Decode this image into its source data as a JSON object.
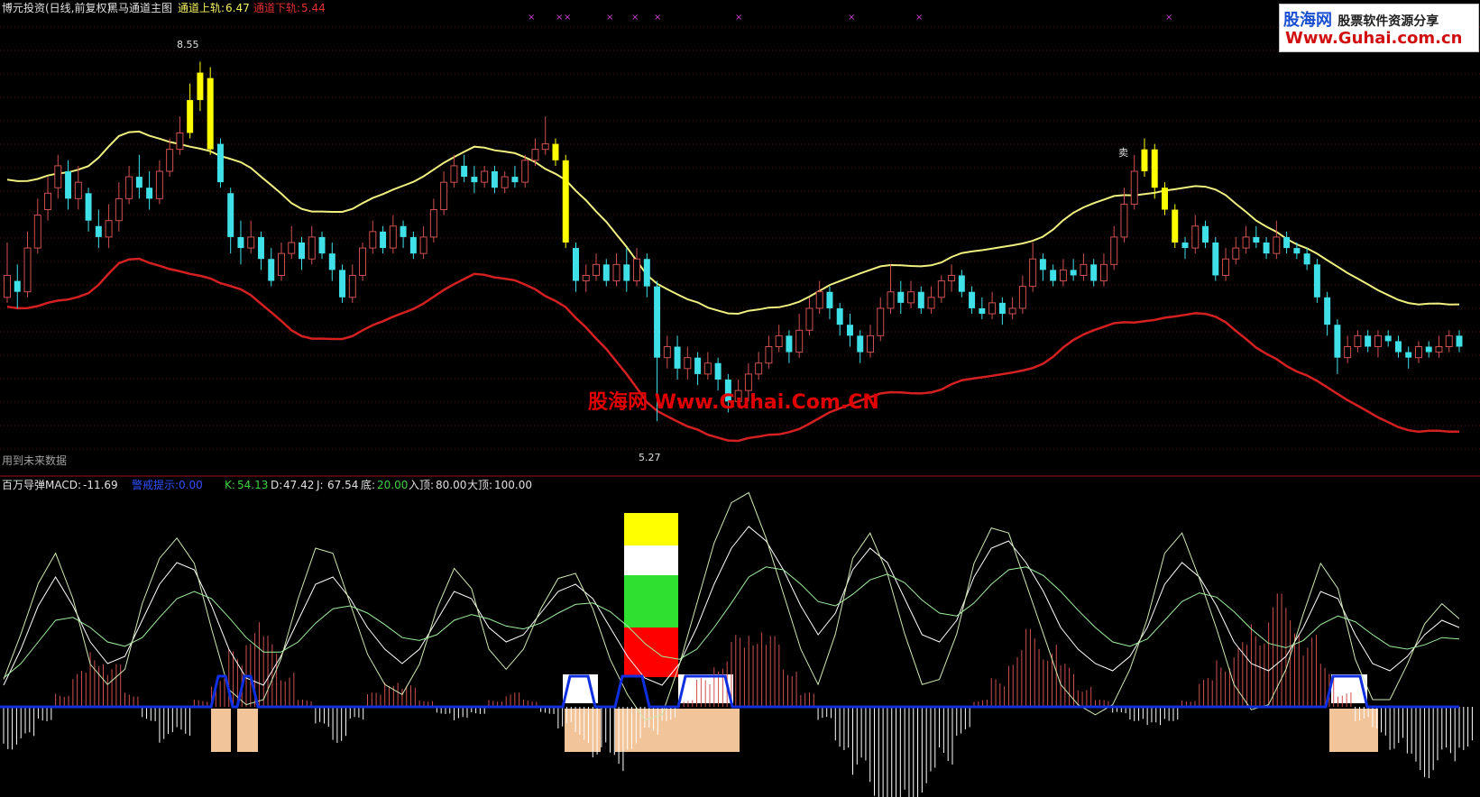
{
  "header": {
    "stock_name": "博元投资",
    "period_info": "(日线,前复权)",
    "indicator_name": "黑马通道主图",
    "upper_label": "通道上轨:",
    "upper_value": "6.47",
    "lower_label": "通道下轨:",
    "lower_value": "5.44"
  },
  "notice": {
    "future_data": "用到未来数据"
  },
  "annotations": {
    "high_price": "8.55",
    "low_price": "5.27",
    "arrow_label": "卖"
  },
  "sub_header": {
    "indicator": "百万导弹",
    "macd_label": "MACD:",
    "macd_value": "-11.69",
    "signal_label": "警戒提示:",
    "signal_value": "0.00",
    "k_label": "K:",
    "k_value": "54.13",
    "d_label": "D:",
    "d_value": "47.42",
    "j_label": "J:",
    "j_value": "67.54",
    "bottom_label": "底:",
    "bottom_value": "20.00",
    "entry_label": "入顶:",
    "entry_value": "80.00",
    "top_label": "大顶:",
    "top_value": "100.00"
  },
  "logo": {
    "brand": "股海网",
    "slogan": "股票软件资源分享",
    "url": "Www.Guhai.com.cn"
  },
  "watermark": {
    "text": "股海网 Www.Guhai.Com.CN"
  },
  "colors": {
    "upper_band": "#f0f080",
    "lower_band": "#d42020",
    "candle_up": "#d05050",
    "candle_down": "#40e0e8",
    "highlight": "#ffff00",
    "k_line": "#ffffff",
    "d_line": "#9ef09e",
    "j_line": "#cfe8b0",
    "macd_pos": "#d05050",
    "macd_neg": "#ffffff",
    "baseline": "#1030e0"
  },
  "chart_data": [
    {
      "type": "candlestick",
      "title": "黑马通道主图",
      "ylim": [
        5.0,
        8.8
      ],
      "price_high": 8.55,
      "price_low": 5.27,
      "candles": [
        [
          6.4,
          6.6,
          6.9,
          6.35
        ],
        [
          6.55,
          6.45,
          6.7,
          6.3
        ],
        [
          6.45,
          6.85,
          7.0,
          6.4
        ],
        [
          6.85,
          7.15,
          7.3,
          6.8
        ],
        [
          7.2,
          7.35,
          7.5,
          7.1
        ],
        [
          7.4,
          7.6,
          7.7,
          7.3
        ],
        [
          7.55,
          7.3,
          7.65,
          7.2
        ],
        [
          7.3,
          7.45,
          7.6,
          7.2
        ],
        [
          7.35,
          7.1,
          7.4,
          7.0
        ],
        [
          7.05,
          6.95,
          7.2,
          6.85
        ],
        [
          6.95,
          7.1,
          7.25,
          6.85
        ],
        [
          7.1,
          7.3,
          7.45,
          7.0
        ],
        [
          7.3,
          7.5,
          7.6,
          7.25
        ],
        [
          7.5,
          7.4,
          7.7,
          7.3
        ],
        [
          7.4,
          7.3,
          7.55,
          7.2
        ],
        [
          7.3,
          7.55,
          7.65,
          7.25
        ],
        [
          7.55,
          7.75,
          7.85,
          7.5
        ],
        [
          7.75,
          7.9,
          8.05,
          7.7
        ],
        [
          7.9,
          8.2,
          8.35,
          7.85
        ],
        [
          8.2,
          8.45,
          8.55,
          8.1
        ],
        [
          8.4,
          7.75,
          8.5,
          7.7
        ],
        [
          7.8,
          7.45,
          7.85,
          7.4
        ],
        [
          7.35,
          6.95,
          7.4,
          6.8
        ],
        [
          6.95,
          6.85,
          7.1,
          6.7
        ],
        [
          6.85,
          6.95,
          7.1,
          6.8
        ],
        [
          6.95,
          6.75,
          7.0,
          6.65
        ],
        [
          6.75,
          6.55,
          6.85,
          6.5
        ],
        [
          6.6,
          6.8,
          6.9,
          6.55
        ],
        [
          6.8,
          6.9,
          7.05,
          6.75
        ],
        [
          6.9,
          6.75,
          6.95,
          6.65
        ],
        [
          6.75,
          6.95,
          7.05,
          6.7
        ],
        [
          6.95,
          6.8,
          7.0,
          6.75
        ],
        [
          6.8,
          6.65,
          6.9,
          6.55
        ],
        [
          6.65,
          6.4,
          6.7,
          6.35
        ],
        [
          6.4,
          6.6,
          6.7,
          6.35
        ],
        [
          6.6,
          6.85,
          6.9,
          6.55
        ],
        [
          6.85,
          7.0,
          7.1,
          6.8
        ],
        [
          7.0,
          6.85,
          7.05,
          6.8
        ],
        [
          6.85,
          7.05,
          7.15,
          6.8
        ],
        [
          7.05,
          6.95,
          7.1,
          6.85
        ],
        [
          6.95,
          6.8,
          7.0,
          6.75
        ],
        [
          6.8,
          6.95,
          7.05,
          6.75
        ],
        [
          6.95,
          7.2,
          7.3,
          6.9
        ],
        [
          7.2,
          7.45,
          7.55,
          7.15
        ],
        [
          7.45,
          7.6,
          7.7,
          7.4
        ],
        [
          7.6,
          7.5,
          7.7,
          7.45
        ],
        [
          7.5,
          7.45,
          7.6,
          7.35
        ],
        [
          7.45,
          7.55,
          7.6,
          7.4
        ],
        [
          7.55,
          7.4,
          7.6,
          7.35
        ],
        [
          7.4,
          7.5,
          7.55,
          7.35
        ],
        [
          7.5,
          7.45,
          7.6,
          7.4
        ],
        [
          7.45,
          7.65,
          7.7,
          7.4
        ],
        [
          7.65,
          7.75,
          7.85,
          7.6
        ],
        [
          7.75,
          7.8,
          8.05,
          7.7
        ],
        [
          7.8,
          7.65,
          7.85,
          7.6
        ],
        [
          7.65,
          6.9,
          7.7,
          6.85
        ],
        [
          6.85,
          6.55,
          6.9,
          6.45
        ],
        [
          6.55,
          6.6,
          6.7,
          6.45
        ],
        [
          6.6,
          6.7,
          6.8,
          6.55
        ],
        [
          6.7,
          6.55,
          6.75,
          6.5
        ],
        [
          6.55,
          6.7,
          6.8,
          6.5
        ],
        [
          6.7,
          6.55,
          6.85,
          6.45
        ],
        [
          6.55,
          6.75,
          6.85,
          6.5
        ],
        [
          6.75,
          6.5,
          6.8,
          6.4
        ],
        [
          6.5,
          5.85,
          6.55,
          5.27
        ],
        [
          5.85,
          5.95,
          6.05,
          5.75
        ],
        [
          5.95,
          5.75,
          6.05,
          5.65
        ],
        [
          5.75,
          5.85,
          5.95,
          5.65
        ],
        [
          5.85,
          5.7,
          5.9,
          5.6
        ],
        [
          5.7,
          5.8,
          5.9,
          5.65
        ],
        [
          5.8,
          5.65,
          5.85,
          5.55
        ],
        [
          5.65,
          5.45,
          5.7,
          5.35
        ],
        [
          5.45,
          5.55,
          5.65,
          5.4
        ],
        [
          5.55,
          5.7,
          5.8,
          5.45
        ],
        [
          5.7,
          5.8,
          5.9,
          5.65
        ],
        [
          5.8,
          5.95,
          6.05,
          5.75
        ],
        [
          5.95,
          6.05,
          6.15,
          5.9
        ],
        [
          6.05,
          5.9,
          6.1,
          5.8
        ],
        [
          5.9,
          6.1,
          6.25,
          5.85
        ],
        [
          6.1,
          6.3,
          6.4,
          6.05
        ],
        [
          6.3,
          6.45,
          6.55,
          6.25
        ],
        [
          6.45,
          6.3,
          6.5,
          6.2
        ],
        [
          6.3,
          6.15,
          6.35,
          6.05
        ],
        [
          6.15,
          6.05,
          6.25,
          5.95
        ],
        [
          6.05,
          5.9,
          6.1,
          5.8
        ],
        [
          5.9,
          6.05,
          6.15,
          5.85
        ],
        [
          6.05,
          6.3,
          6.4,
          6.0
        ],
        [
          6.3,
          6.45,
          6.7,
          6.25
        ],
        [
          6.45,
          6.35,
          6.55,
          6.25
        ],
        [
          6.35,
          6.45,
          6.55,
          6.3
        ],
        [
          6.45,
          6.3,
          6.5,
          6.25
        ],
        [
          6.3,
          6.4,
          6.5,
          6.25
        ],
        [
          6.4,
          6.55,
          6.6,
          6.35
        ],
        [
          6.55,
          6.6,
          6.7,
          6.45
        ],
        [
          6.6,
          6.45,
          6.65,
          6.4
        ],
        [
          6.45,
          6.3,
          6.5,
          6.25
        ],
        [
          6.3,
          6.25,
          6.4,
          6.2
        ],
        [
          6.25,
          6.35,
          6.45,
          6.2
        ],
        [
          6.35,
          6.25,
          6.4,
          6.15
        ],
        [
          6.25,
          6.3,
          6.4,
          6.2
        ],
        [
          6.3,
          6.5,
          6.6,
          6.25
        ],
        [
          6.5,
          6.75,
          6.9,
          6.45
        ],
        [
          6.75,
          6.65,
          6.8,
          6.55
        ],
        [
          6.65,
          6.55,
          6.7,
          6.5
        ],
        [
          6.55,
          6.65,
          6.75,
          6.5
        ],
        [
          6.65,
          6.6,
          6.75,
          6.55
        ],
        [
          6.6,
          6.7,
          6.8,
          6.55
        ],
        [
          6.7,
          6.55,
          6.75,
          6.5
        ],
        [
          6.55,
          6.7,
          6.8,
          6.5
        ],
        [
          6.7,
          6.95,
          7.05,
          6.65
        ],
        [
          6.95,
          7.25,
          7.4,
          6.9
        ],
        [
          7.25,
          7.55,
          7.7,
          7.2
        ],
        [
          7.55,
          7.75,
          7.85,
          7.5
        ],
        [
          7.75,
          7.4,
          7.8,
          7.3
        ],
        [
          7.4,
          7.2,
          7.45,
          7.15
        ],
        [
          7.2,
          6.9,
          7.25,
          6.85
        ],
        [
          6.9,
          6.85,
          6.95,
          6.75
        ],
        [
          6.85,
          7.05,
          7.15,
          6.8
        ],
        [
          7.05,
          6.9,
          7.1,
          6.85
        ],
        [
          6.9,
          6.6,
          6.95,
          6.55
        ],
        [
          6.6,
          6.75,
          6.85,
          6.55
        ],
        [
          6.75,
          6.85,
          6.95,
          6.7
        ],
        [
          6.85,
          6.95,
          7.05,
          6.8
        ],
        [
          6.95,
          6.9,
          7.05,
          6.85
        ],
        [
          6.9,
          6.8,
          6.95,
          6.75
        ],
        [
          6.8,
          6.95,
          7.1,
          6.75
        ],
        [
          6.95,
          6.85,
          7.0,
          6.8
        ],
        [
          6.85,
          6.8,
          6.9,
          6.75
        ],
        [
          6.8,
          6.7,
          6.85,
          6.65
        ],
        [
          6.7,
          6.4,
          6.75,
          6.35
        ],
        [
          6.4,
          6.15,
          6.45,
          6.05
        ],
        [
          6.15,
          5.85,
          6.2,
          5.7
        ],
        [
          5.85,
          5.95,
          6.05,
          5.8
        ],
        [
          5.95,
          6.05,
          6.1,
          5.9
        ],
        [
          6.05,
          5.95,
          6.1,
          5.9
        ],
        [
          5.95,
          6.05,
          6.1,
          5.85
        ],
        [
          6.05,
          6.0,
          6.1,
          5.95
        ],
        [
          6.0,
          5.9,
          6.05,
          5.85
        ],
        [
          5.9,
          5.85,
          5.95,
          5.75
        ],
        [
          5.85,
          5.95,
          6.0,
          5.8
        ],
        [
          5.95,
          5.9,
          6.0,
          5.85
        ],
        [
          5.9,
          5.95,
          6.05,
          5.85
        ],
        [
          5.95,
          6.05,
          6.1,
          5.9
        ],
        [
          6.05,
          5.95,
          6.1,
          5.9
        ]
      ],
      "highlighted_candles": [
        18,
        19,
        20,
        54,
        55,
        112,
        113,
        114,
        115
      ]
    },
    {
      "type": "line",
      "title": "百万导弹",
      "ylim": [
        -60,
        140
      ],
      "reference_lines": [
        20,
        80,
        100
      ],
      "series": [
        {
          "name": "K",
          "values": [
            15,
            40,
            70,
            90,
            70,
            45,
            30,
            35,
            60,
            85,
            100,
            95,
            70,
            40,
            20,
            15,
            35,
            60,
            85,
            90,
            75,
            55,
            40,
            30,
            40,
            60,
            80,
            75,
            55,
            45,
            50,
            65,
            80,
            85,
            75,
            55,
            35,
            20,
            15,
            30,
            55,
            85,
            110,
            125,
            115,
            95,
            70,
            50,
            65,
            95,
            110,
            100,
            75,
            50,
            45,
            60,
            90,
            110,
            115,
            100,
            80,
            55,
            40,
            30,
            25,
            35,
            55,
            85,
            100,
            90,
            70,
            45,
            30,
            25,
            35,
            55,
            80,
            75,
            50,
            30,
            25,
            35,
            50,
            60,
            55
          ]
        },
        {
          "name": "D",
          "values": [
            20,
            30,
            45,
            60,
            62,
            55,
            45,
            42,
            48,
            62,
            75,
            80,
            75,
            62,
            48,
            38,
            38,
            45,
            58,
            68,
            70,
            65,
            57,
            48,
            46,
            50,
            60,
            64,
            61,
            56,
            54,
            58,
            65,
            71,
            72,
            66,
            56,
            44,
            35,
            33,
            40,
            55,
            72,
            90,
            97,
            95,
            85,
            73,
            70,
            78,
            88,
            92,
            86,
            74,
            65,
            63,
            72,
            85,
            95,
            97,
            91,
            80,
            67,
            55,
            45,
            42,
            47,
            60,
            73,
            79,
            76,
            66,
            54,
            44,
            41,
            46,
            57,
            63,
            59,
            50,
            42,
            40,
            43,
            48,
            47
          ]
        },
        {
          "name": "J",
          "values": [
            10,
            55,
            105,
            135,
            90,
            25,
            5,
            20,
            85,
            130,
            150,
            125,
            60,
            0,
            -15,
            -10,
            30,
            90,
            140,
            135,
            85,
            35,
            5,
            -5,
            25,
            80,
            120,
            100,
            40,
            20,
            40,
            80,
            110,
            115,
            80,
            30,
            -5,
            -30,
            -25,
            25,
            85,
            145,
            185,
            195,
            150,
            95,
            40,
            5,
            55,
            130,
            155,
            115,
            55,
            5,
            10,
            55,
            125,
            160,
            155,
            105,
            55,
            5,
            -15,
            -25,
            -15,
            20,
            70,
            135,
            155,
            110,
            60,
            5,
            -20,
            -15,
            20,
            75,
            125,
            100,
            30,
            -10,
            -10,
            25,
            65,
            85,
            70
          ]
        }
      ],
      "macd_hist": [
        -30,
        -25,
        -10,
        10,
        25,
        40,
        30,
        10,
        -10,
        -25,
        -20,
        5,
        20,
        40,
        60,
        50,
        25,
        5,
        -15,
        -25,
        -10,
        10,
        20,
        15,
        5,
        -5,
        -10,
        -5,
        5,
        10,
        5,
        -5,
        -15,
        -25,
        -35,
        -45,
        -30,
        -20,
        -10,
        5,
        20,
        35,
        50,
        60,
        50,
        30,
        10,
        -10,
        -30,
        -50,
        -70,
        -90,
        -80,
        -60,
        -40,
        -20,
        5,
        20,
        40,
        55,
        45,
        30,
        15,
        5,
        -5,
        -10,
        -15,
        -10,
        5,
        20,
        35,
        45,
        60,
        80,
        70,
        50,
        30,
        10,
        -10,
        -20,
        -30,
        -45,
        -50,
        -40,
        -30
      ],
      "warning_value": 0.0,
      "k": 54.13,
      "d": 47.42,
      "j": 67.54,
      "macd": -11.69
    }
  ]
}
